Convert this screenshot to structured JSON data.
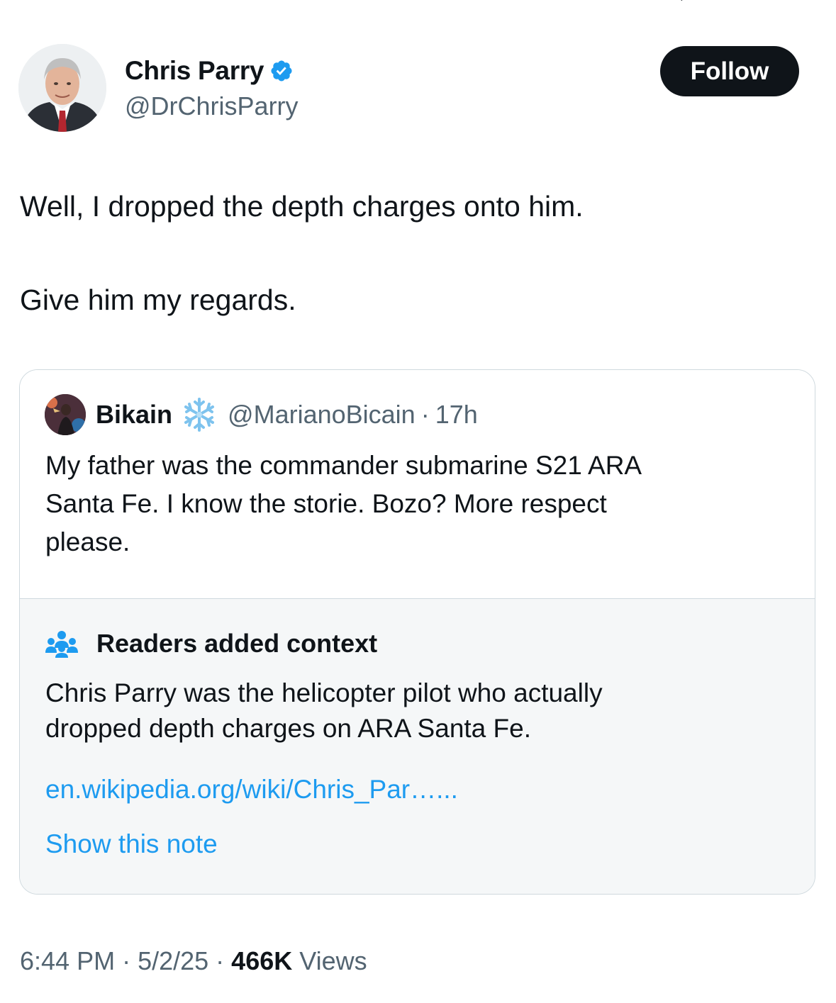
{
  "author": {
    "display_name": "Chris Parry",
    "handle": "@DrChrisParry",
    "verified_icon": "verified-badge-icon",
    "follow_label": "Follow"
  },
  "tweet": {
    "lines": [
      "Well, I dropped the depth charges onto him.",
      "Give him my regards."
    ]
  },
  "quoted": {
    "display_name": "Bikain",
    "badge_icon": "snowflake-icon",
    "handle": "@MarianoBicain",
    "separator": "·",
    "time": "17h",
    "lines": [
      "My father was the commander submarine S21 ARA",
      "Santa Fe. I know the storie. Bozo? More respect",
      "please."
    ]
  },
  "context": {
    "icon": "people-icon",
    "title": "Readers added context",
    "lines": [
      "Chris Parry was the helicopter pilot who actually",
      "dropped depth charges on ARA Santa Fe."
    ],
    "link": "en.wikipedia.org/wiki/Chris_Par…...",
    "show_label": "Show this note"
  },
  "meta": {
    "time": "6:44 PM",
    "sep1": "·",
    "date": "5/2/25",
    "sep2": "·",
    "views_count": "466K",
    "views_label": "Views"
  },
  "colors": {
    "text": "#0f1419",
    "secondary": "#536471",
    "link": "#1d9bf0",
    "verified": "#1d9bf0",
    "note_background": "#f5f7f8",
    "border": "#cfd9de"
  }
}
